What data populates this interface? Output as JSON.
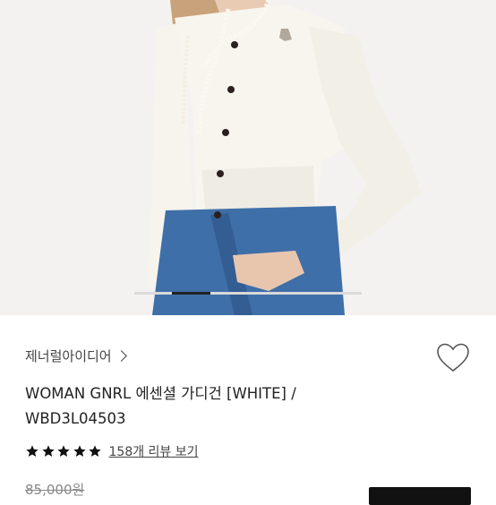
{
  "product": {
    "brand": "제너럴아이디어",
    "title_line1": "WOMAN GNRL 에센셜 가디건 [WHITE] /",
    "title_line2": "WBD3L04503",
    "review_link": "158개 리뷰 보기",
    "rating": 5,
    "original_price": "85,000원"
  },
  "gallery": {
    "progress": 0.17
  },
  "icons": {
    "brand_chevron": "chevron-right-icon",
    "wishlist": "heart-outline-icon",
    "star": "star-icon"
  },
  "colors": {
    "accent": "#111111",
    "star": "#111111",
    "cardigan": "#f6f4ec",
    "jeans": "#3f6fa8"
  }
}
